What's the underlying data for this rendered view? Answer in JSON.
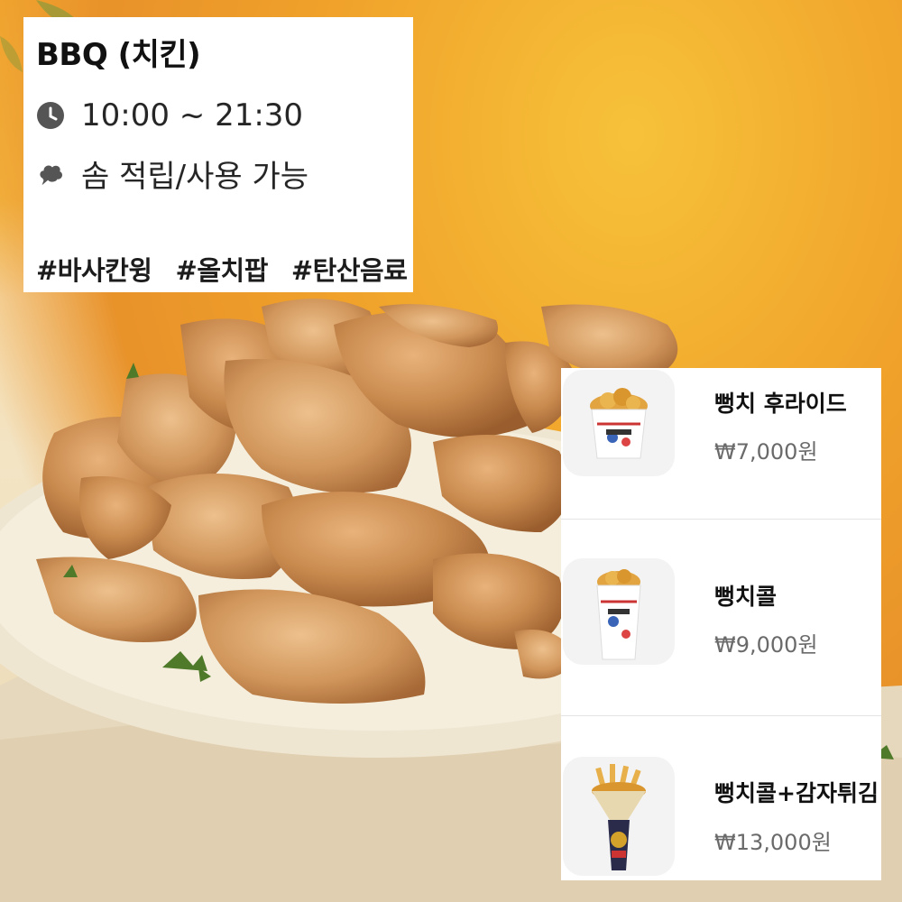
{
  "store": {
    "title": "BBQ (치킨)",
    "hours": "10:00 ~ 21:30",
    "points": "솜 적립/사용 가능",
    "tags": [
      "#바사칸윙",
      "#올치팝",
      "#탄산음료"
    ]
  },
  "icons": {
    "hours": "clock-icon",
    "points": "cotton-icon"
  },
  "menu": {
    "items": [
      {
        "name": "뻥치 후라이드",
        "price": "₩7,000원",
        "image": "fried-chicken-bucket"
      },
      {
        "name": "뻥치콜",
        "price": "₩9,000원",
        "image": "chicken-cup"
      },
      {
        "name": "뻥치콜+감자튀김",
        "price": "₩13,000원",
        "image": "chicken-fries-cone"
      }
    ]
  },
  "colors": {
    "background_top": "#f2a830",
    "background_bottom": "#efe0c0",
    "chicken": "#c9864a",
    "card": "#ffffff",
    "price_text": "#6a6a6a"
  }
}
